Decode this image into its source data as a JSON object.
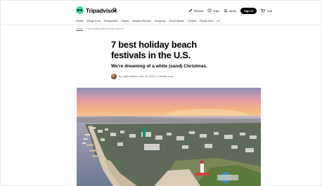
{
  "header": {
    "brand": "Tripadvisor",
    "nav": [
      {
        "label": "Review",
        "icon": "pencil-icon"
      },
      {
        "label": "Trips",
        "icon": "heart-icon"
      },
      {
        "label": "Alerts",
        "icon": "bell-icon"
      }
    ],
    "sign_in_label": "Sign in",
    "cart_label": "Cart"
  },
  "subnav": {
    "items": [
      "Hotels",
      "Things to do",
      "Restaurants",
      "Flights",
      "Vacation Rentals",
      "Shopping",
      "Travel Stories",
      "Cruises",
      "Rental Cars"
    ],
    "more_label": "•••"
  },
  "breadcrumb": {
    "home": "Articles",
    "current": "7 best holiday beach festivals in the U.S."
  },
  "article": {
    "title": "7 best holiday beach festivals in the U.S.",
    "subtitle": "We're dreaming of a white (sand) Christmas.",
    "byline": "By Caitlin Morton • Nov 10, 2022 • 3 minutes read"
  },
  "colors": {
    "brand_green": "#34e0a1",
    "sign_in_bg": "#000000"
  }
}
